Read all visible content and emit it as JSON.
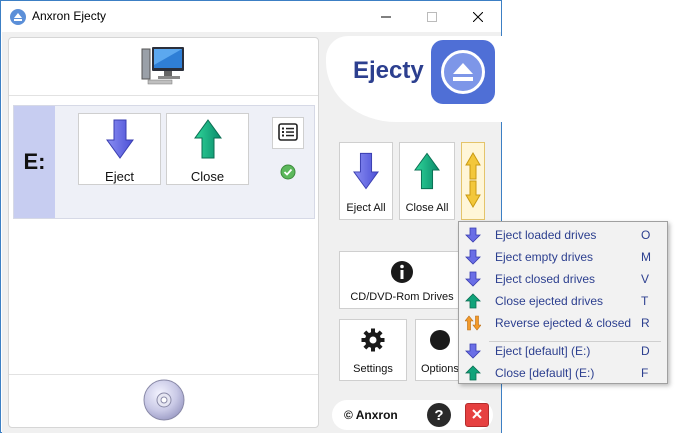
{
  "window": {
    "title": "Anxron Ejecty"
  },
  "drive": {
    "letter": "E:",
    "eject_label": "Eject",
    "close_label": "Close"
  },
  "brand": {
    "name": "Ejecty"
  },
  "right_buttons": {
    "eject_all": "Eject All",
    "close_all": "Close All",
    "cd_drives": "CD/DVD-Rom Drives",
    "settings": "Settings",
    "options": "Options"
  },
  "footer": {
    "brand": "© Anxron",
    "help": "?"
  },
  "menu": {
    "items": [
      {
        "label": "Eject loaded drives",
        "key": "O",
        "icon": "eject-arrow-icon"
      },
      {
        "label": "Eject empty drives",
        "key": "M",
        "icon": "eject-arrow-icon"
      },
      {
        "label": "Eject closed drives",
        "key": "V",
        "icon": "eject-arrow-icon"
      },
      {
        "label": "Close ejected drives",
        "key": "T",
        "icon": "close-arrow-icon"
      },
      {
        "label": "Reverse ejected & closed",
        "key": "R",
        "icon": "reverse-arrows-icon"
      },
      {
        "label": "Eject [default] (E:)",
        "key": "D",
        "icon": "eject-arrow-icon"
      },
      {
        "label": "Close [default] (E:)",
        "key": "F",
        "icon": "close-arrow-icon"
      }
    ]
  },
  "colors": {
    "accent": "#2c3f8f",
    "eject_arrow": "#6a6ee6",
    "close_arrow": "#10a37a",
    "drive_letter_bg": "#c7cdf1",
    "exit_red": "#e64040"
  }
}
